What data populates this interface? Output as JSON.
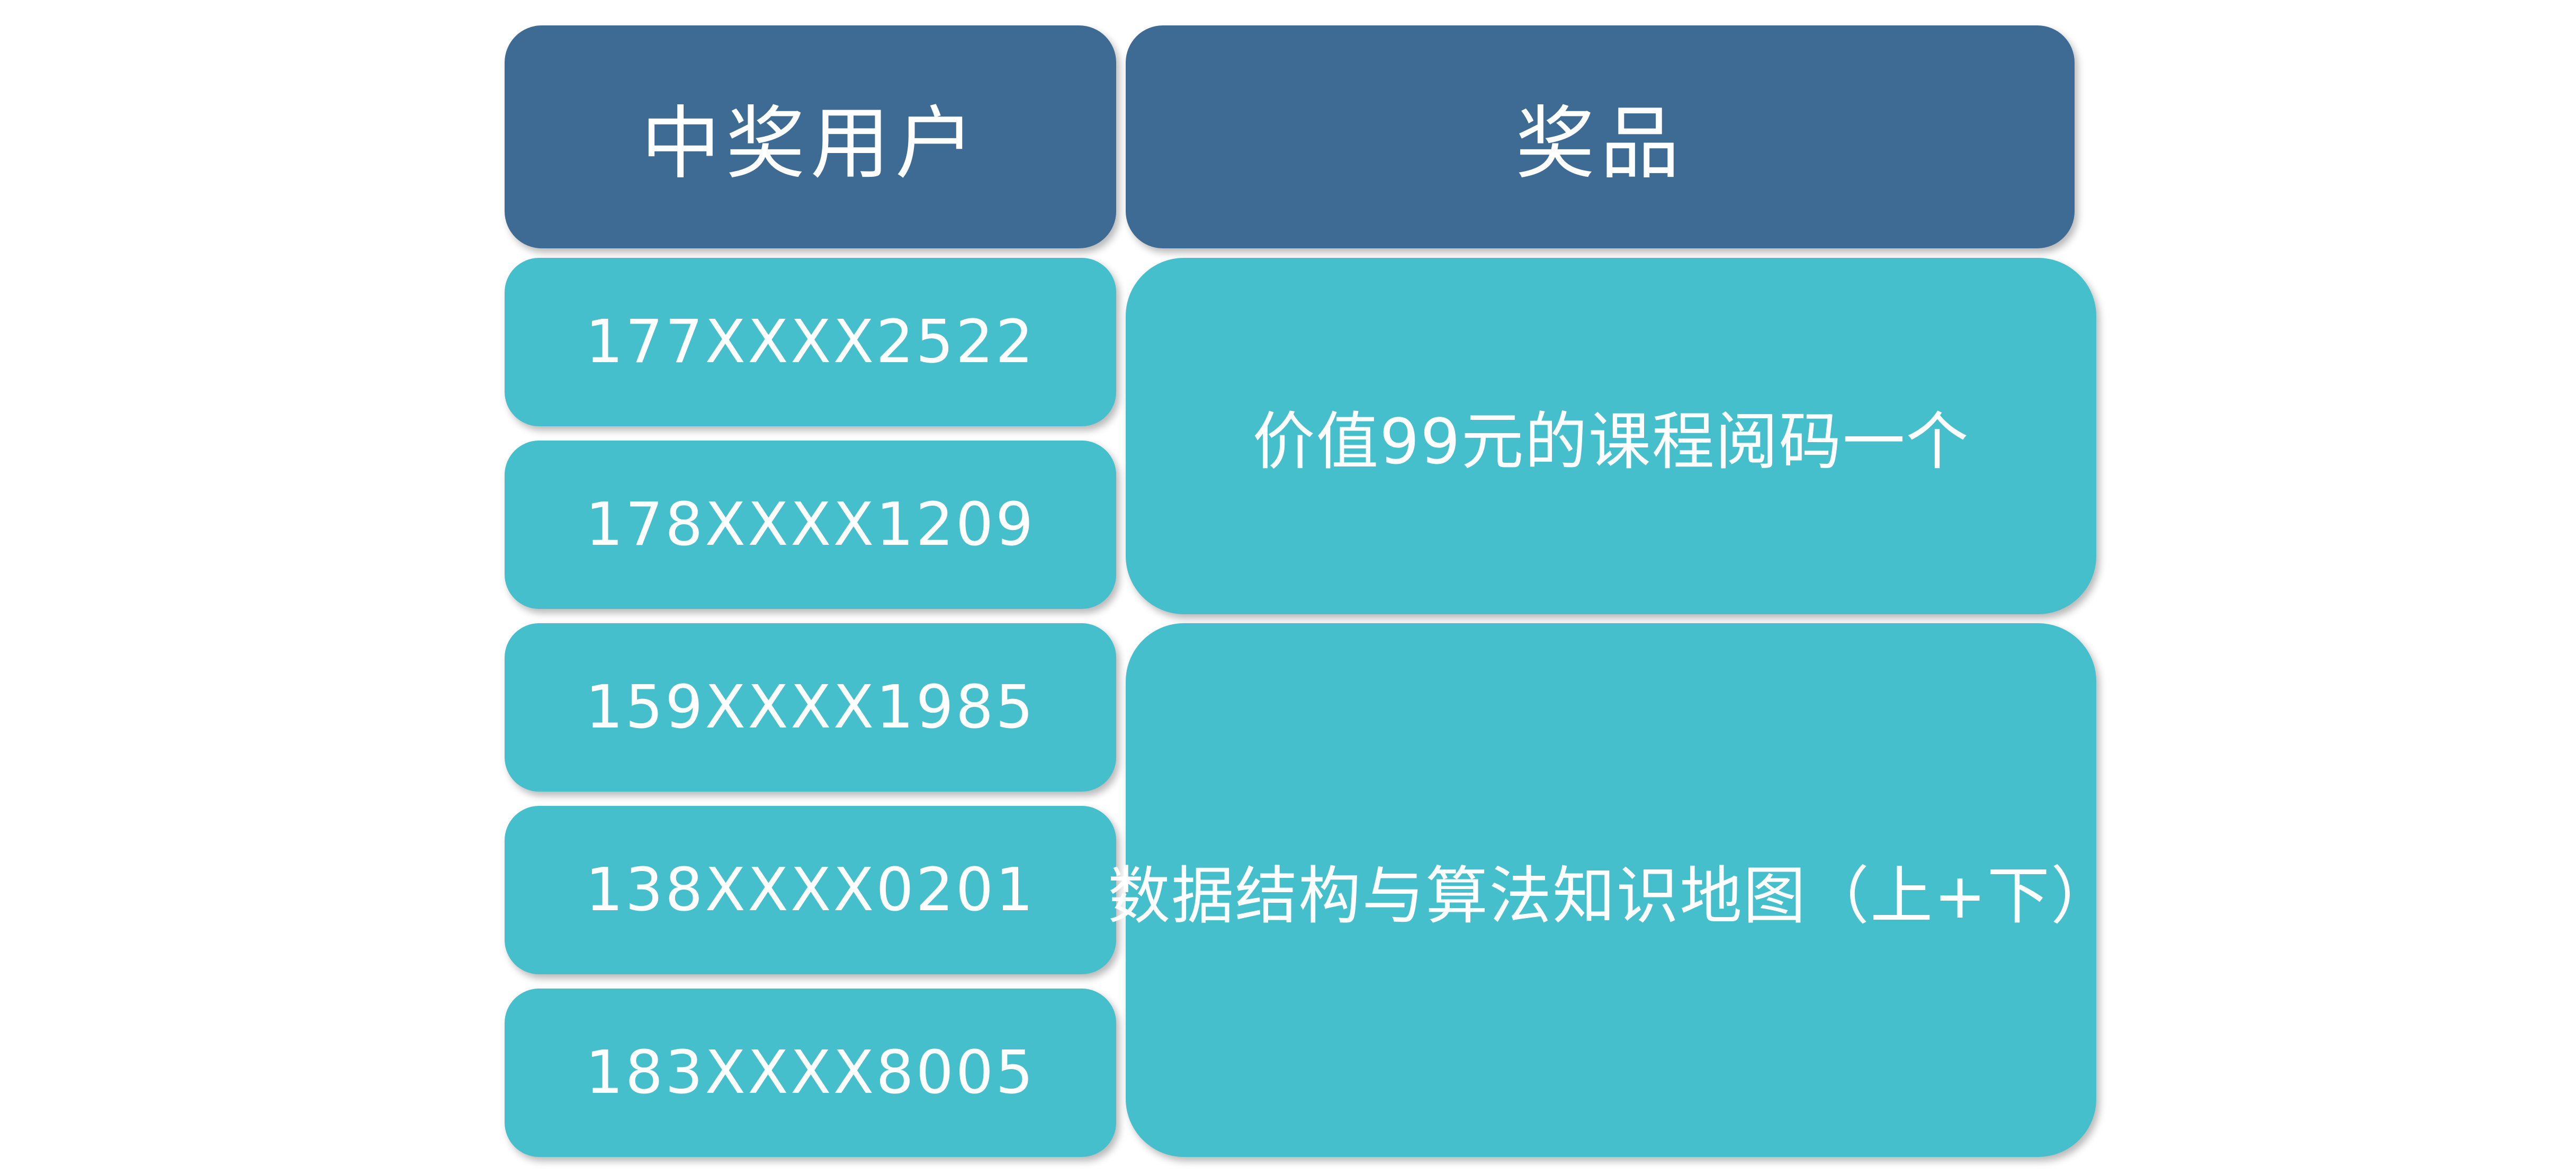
{
  "colors": {
    "header_bg": "#3e6b93",
    "cell_bg": "#44bfcb",
    "text": "#ffffff"
  },
  "table": {
    "headers": {
      "user": "中奖用户",
      "prize": "奖品"
    },
    "winners": [
      "177XXXX2522",
      "178XXXX1209",
      "159XXXX1985",
      "138XXXX0201",
      "183XXXX8005"
    ],
    "prizes": [
      "价值99元的课程阅码一个",
      "数据结构与算法知识地图（上+下）"
    ]
  }
}
